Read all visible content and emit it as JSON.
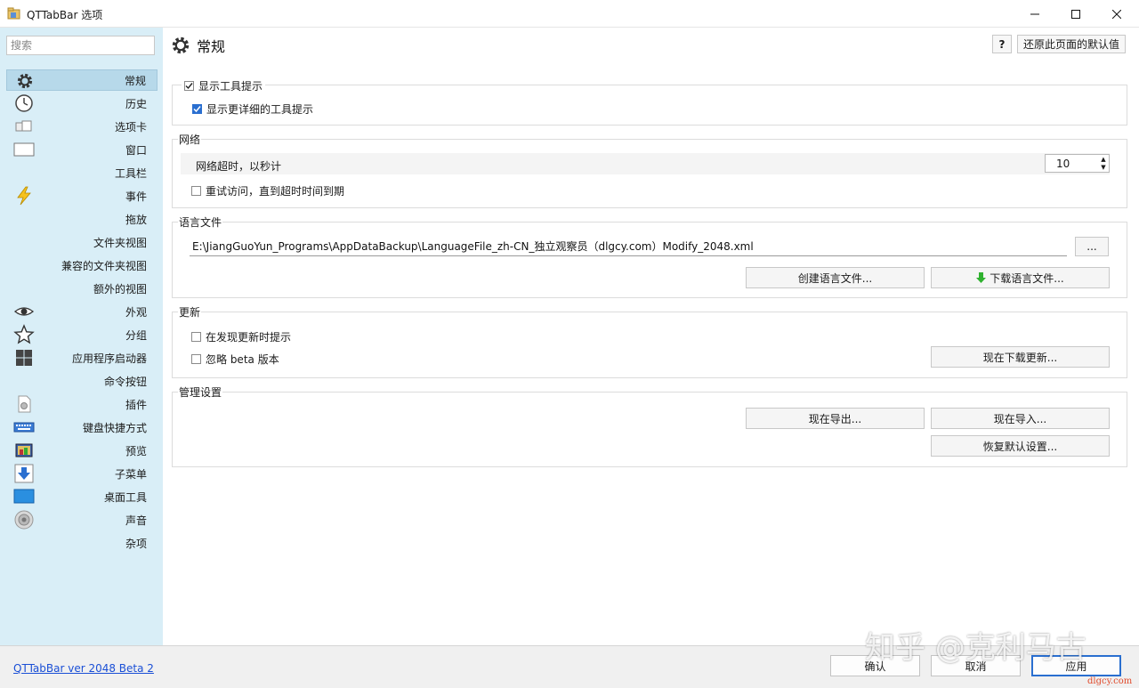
{
  "window": {
    "title": "QTTabBar 选项"
  },
  "sidebar": {
    "search_placeholder": "搜索",
    "items": [
      {
        "label": "常规",
        "icon": "gear-icon",
        "active": true
      },
      {
        "label": "历史",
        "icon": "clock-icon"
      },
      {
        "label": "选项卡",
        "icon": "tabs-icon"
      },
      {
        "label": "窗口",
        "icon": "window-icon"
      },
      {
        "label": "工具栏",
        "icon": ""
      },
      {
        "label": "事件",
        "icon": "lightning-icon"
      },
      {
        "label": "拖放",
        "icon": ""
      },
      {
        "label": "文件夹视图",
        "icon": ""
      },
      {
        "label": "兼容的文件夹视图",
        "icon": ""
      },
      {
        "label": "额外的视图",
        "icon": ""
      },
      {
        "label": "外观",
        "icon": "eye-icon"
      },
      {
        "label": "分组",
        "icon": "star-icon"
      },
      {
        "label": "应用程序启动器",
        "icon": "windows-icon"
      },
      {
        "label": "命令按钮",
        "icon": ""
      },
      {
        "label": "插件",
        "icon": "plugin-icon"
      },
      {
        "label": "键盘快捷方式",
        "icon": "keyboard-icon"
      },
      {
        "label": "预览",
        "icon": "preview-icon"
      },
      {
        "label": "子菜单",
        "icon": "download-arrow-icon"
      },
      {
        "label": "桌面工具",
        "icon": "desktop-icon"
      },
      {
        "label": "声音",
        "icon": "speaker-icon"
      },
      {
        "label": "杂项",
        "icon": ""
      }
    ]
  },
  "main": {
    "title": "常规",
    "help_label": "?",
    "restore_label": "还原此页面的默认值",
    "tooltips_group": {
      "show_tooltips": "显示工具提示",
      "show_detailed_tooltips": "显示更详细的工具提示"
    },
    "network_group": {
      "title": "网络",
      "timeout_label": "网络超时，以秒计",
      "timeout_value": "10",
      "retry_label": "重试访问，直到超时时间到期"
    },
    "language_group": {
      "title": "语言文件",
      "path": "E:\\JiangGuoYun_Programs\\AppDataBackup\\LanguageFile_zh-CN_独立观察员（dlgcy.com）Modify_2048.xml",
      "browse_label": "...",
      "create_label": "创建语言文件...",
      "download_label": "下载语言文件..."
    },
    "update_group": {
      "title": "更新",
      "notify_label": "在发现更新时提示",
      "ignore_beta_label": "忽略 beta 版本",
      "download_now_label": "现在下载更新..."
    },
    "admin_group": {
      "title": "管理设置",
      "export_label": "现在导出...",
      "import_label": "现在导入...",
      "restore_defaults_label": "恢复默认设置..."
    }
  },
  "footer": {
    "version_link": "QTTabBar ver 2048 Beta 2",
    "ok_label": "确认",
    "cancel_label": "取消",
    "apply_label": "应用"
  },
  "watermark": {
    "text": "知乎 @克利马古",
    "site": "dlgcy.com"
  },
  "colors": {
    "sidebar_bg": "#d9eef7",
    "active_item": "#b7d9ea",
    "accent": "#2a6fd0",
    "link": "#1a4fd6",
    "download_arrow": "#2fb12f"
  }
}
